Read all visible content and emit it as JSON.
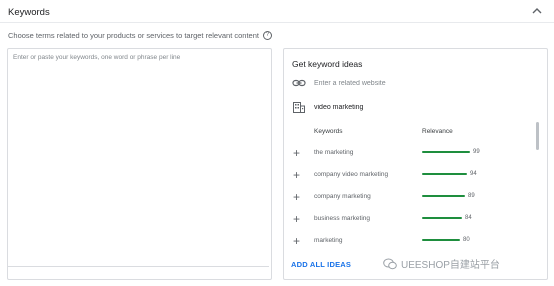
{
  "section": {
    "title": "Keywords",
    "subtitle": "Choose terms related to your products or services to target relevant content",
    "help_icon": "help-circle-icon",
    "collapse_icon": "chevron-up-icon"
  },
  "keywords_input": {
    "placeholder": "Enter or paste your keywords, one word or phrase per line",
    "value": ""
  },
  "ideas": {
    "title": "Get keyword ideas",
    "website_placeholder": "Enter a related website",
    "website_icon": "link-icon",
    "product_icon": "building-icon",
    "product_value": "video marketing",
    "columns": {
      "keywords": "Keywords",
      "relevance": "Relevance"
    },
    "rows": [
      {
        "keyword": "the marketing",
        "relevance": 99
      },
      {
        "keyword": "company video marketing",
        "relevance": 94
      },
      {
        "keyword": "company marketing",
        "relevance": 89
      },
      {
        "keyword": "business marketing",
        "relevance": 84
      },
      {
        "keyword": "marketing",
        "relevance": 80
      }
    ],
    "add_all_label": "ADD ALL IDEAS"
  },
  "watermark": {
    "text": "UEESHOP自建站平台"
  },
  "colors": {
    "accent_blue": "#1a73e8",
    "relevance_green": "#1e8e3e",
    "border": "#dadce0"
  }
}
